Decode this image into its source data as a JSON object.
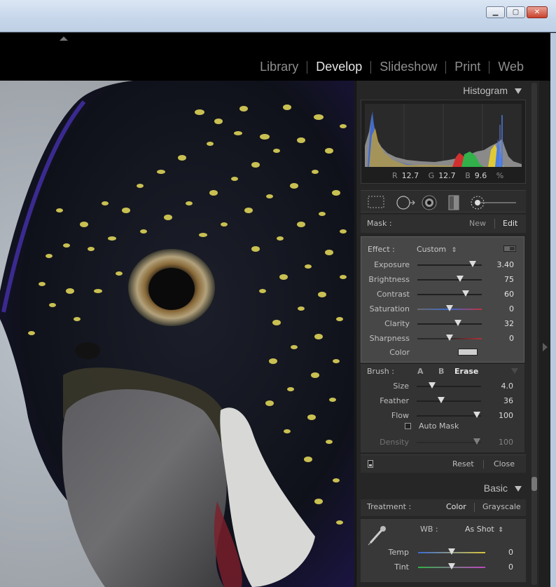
{
  "window": {
    "minimize_glyph": "▁",
    "maximize_glyph": "▢",
    "close_glyph": "✕"
  },
  "modules": [
    {
      "label": "Library",
      "active": false
    },
    {
      "label": "Develop",
      "active": true
    },
    {
      "label": "Slideshow",
      "active": false
    },
    {
      "label": "Print",
      "active": false
    },
    {
      "label": "Web",
      "active": false
    }
  ],
  "histogram": {
    "title": "Histogram",
    "r_label": "R",
    "r_value": "12.7",
    "g_label": "G",
    "g_value": "12.7",
    "b_label": "B",
    "b_value": "9.6",
    "unit": "%"
  },
  "tools": [
    "crop-overlay-icon",
    "spot-removal-icon",
    "red-eye-icon",
    "graduated-filter-icon",
    "adjustment-brush-icon"
  ],
  "mask": {
    "label": "Mask :",
    "new_label": "New",
    "edit_label": "Edit"
  },
  "effect": {
    "label": "Effect :",
    "preset": "Custom",
    "sliders": [
      {
        "label": "Exposure",
        "value": "3.40",
        "pos": 0.86
      },
      {
        "label": "Brightness",
        "value": "75",
        "pos": 0.66
      },
      {
        "label": "Contrast",
        "value": "60",
        "pos": 0.75
      },
      {
        "label": "Saturation",
        "value": "0",
        "pos": 0.5
      },
      {
        "label": "Clarity",
        "value": "32",
        "pos": 0.63
      },
      {
        "label": "Sharpness",
        "value": "0",
        "pos": 0.5
      }
    ],
    "color_label": "Color"
  },
  "brush": {
    "label": "Brush :",
    "a_label": "A",
    "b_label": "B",
    "erase_label": "Erase",
    "sliders": [
      {
        "label": "Size",
        "value": "4.0",
        "pos": 0.24
      },
      {
        "label": "Feather",
        "value": "36",
        "pos": 0.38
      },
      {
        "label": "Flow",
        "value": "100",
        "pos": 0.94
      }
    ],
    "auto_mask_label": "Auto Mask",
    "density_label": "Density",
    "density_value": "100",
    "density_pos": 0.94
  },
  "footer": {
    "reset_label": "Reset",
    "close_label": "Close"
  },
  "basic": {
    "title": "Basic",
    "treatment_label": "Treatment :",
    "color_label": "Color",
    "grayscale_label": "Grayscale",
    "wb_label": "WB :",
    "wb_value": "As Shot",
    "temp_label": "Temp",
    "temp_value": "0",
    "tint_label": "Tint",
    "tint_value": "0"
  }
}
